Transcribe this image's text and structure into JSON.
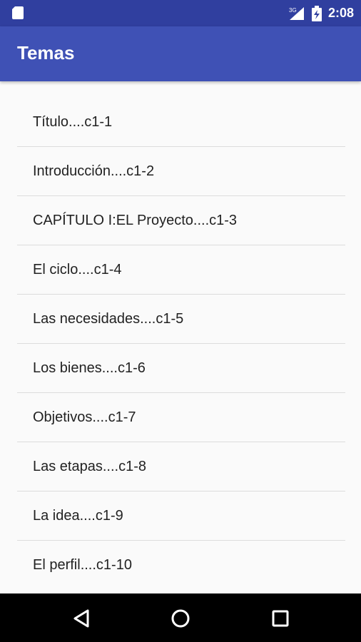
{
  "status_bar": {
    "time": "2:08",
    "network_label": "3G",
    "icons": [
      "sd-card-icon",
      "signal-icon",
      "battery-charging-icon"
    ]
  },
  "app_bar": {
    "title": "Temas"
  },
  "topics": [
    "Título....c1-1",
    "Introducción....c1-2",
    "CAPÍTULO I:EL Proyecto....c1-3",
    "El ciclo....c1-4",
    "Las necesidades....c1-5",
    "Los bienes....c1-6",
    "Objetivos....c1-7",
    "Las etapas....c1-8",
    "La idea....c1-9",
    "El perfil....c1-10"
  ],
  "nav_bar": {
    "icons": [
      "back-icon",
      "home-icon",
      "recents-icon"
    ]
  },
  "colors": {
    "primary": "#3f51b5",
    "primary_dark": "#303f9f",
    "background": "#fafafa"
  }
}
